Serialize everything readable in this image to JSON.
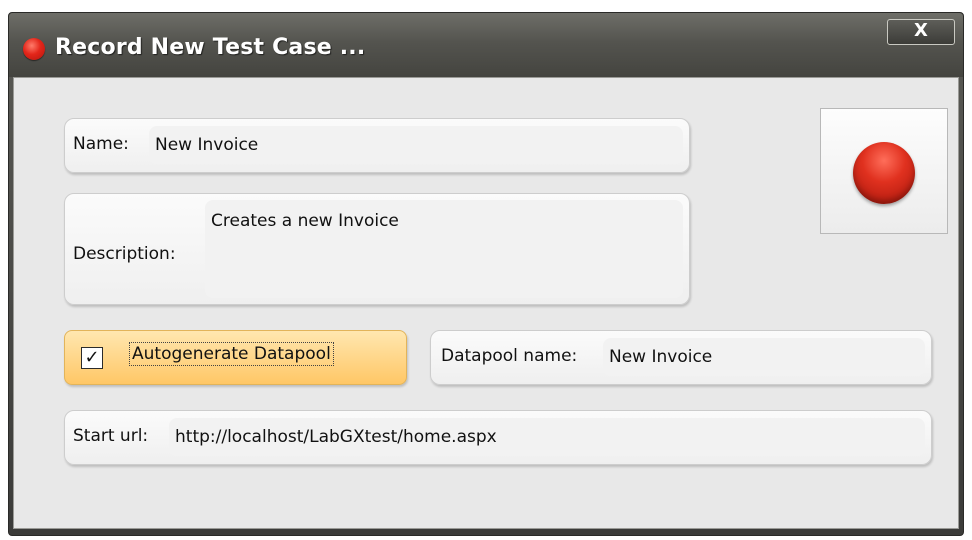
{
  "window": {
    "title": "Record New Test Case ...",
    "close_label": "X"
  },
  "form": {
    "name_label": "Name:",
    "name_value": "New Invoice",
    "description_label": "Description:",
    "description_value": "Creates a new Invoice",
    "autogenerate": {
      "label": "Autogenerate Datapool",
      "checked": true,
      "check_glyph": "✓"
    },
    "datapool_label": "Datapool name:",
    "datapool_value": "New Invoice",
    "start_url_label": "Start url:",
    "start_url_value": "http://localhost/LabGXtest/home.aspx"
  },
  "icons": {
    "title": "record-dot-icon",
    "record_button": "record-icon"
  },
  "colors": {
    "record_red": "#e0311f",
    "highlight_orange": "#ffc766",
    "title_bar": "#54544f"
  }
}
